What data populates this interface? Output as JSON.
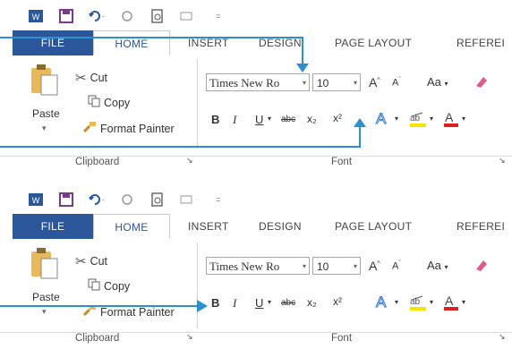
{
  "qat": {
    "icons": [
      "word-app-icon",
      "save-icon",
      "undo-icon",
      "redo-icon",
      "print-preview-icon",
      "touch-mode-icon",
      "customize-qat-icon"
    ]
  },
  "tabs": [
    "FILE",
    "HOME",
    "INSERT",
    "DESIGN",
    "PAGE LAYOUT",
    "REFEREI"
  ],
  "clipboard": {
    "paste": "Paste",
    "cut": "Cut",
    "copy": "Copy",
    "format_painter": "Format Painter",
    "group_label": "Clipboard"
  },
  "font": {
    "name": "Times New Ro",
    "size": "10",
    "group_label": "Font",
    "bold": "B",
    "italic": "I",
    "underline": "U",
    "strike": "abc",
    "sub": "x₂",
    "sup": "x²",
    "grow": "A",
    "shrink": "A",
    "case": "Aa"
  },
  "colors": {
    "file_tab": "#2b579a",
    "arrow": "#2e8fd0",
    "font_color_bar": "#e02020",
    "highlight_bar": "#f5e400"
  }
}
